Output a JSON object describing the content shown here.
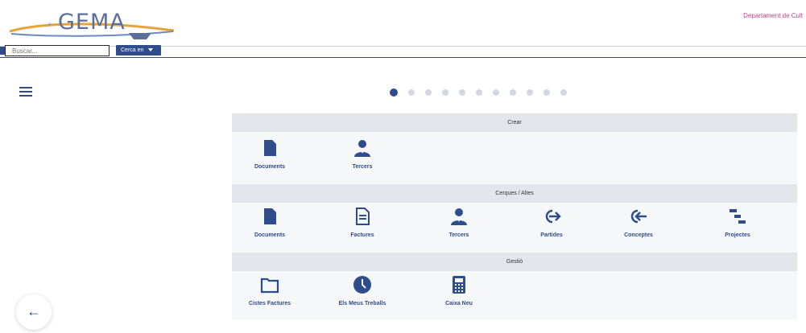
{
  "header": {
    "logo_text": "GEMA",
    "logo_small_text": "e·",
    "department": "Departament de Cult"
  },
  "search": {
    "placeholder": "Buscar...",
    "select_label": "Cerca en"
  },
  "carousel": {
    "total": 11,
    "active": 1
  },
  "sections": [
    {
      "title": "Crear",
      "items": [
        {
          "label": "Documents",
          "icon": "document-icon"
        },
        {
          "label": "Tercers",
          "icon": "user-icon"
        }
      ]
    },
    {
      "title": "Cerques / Altes",
      "items": [
        {
          "label": "Documents",
          "icon": "document-icon"
        },
        {
          "label": "Factures",
          "icon": "invoice-icon"
        },
        {
          "label": "Tercers",
          "icon": "user-icon"
        },
        {
          "label": "Partides",
          "icon": "arrow-right-icon"
        },
        {
          "label": "Conceptes",
          "icon": "arrow-left-icon"
        },
        {
          "label": "Projectes",
          "icon": "tasks-icon"
        }
      ]
    },
    {
      "title": "Gestió",
      "items": [
        {
          "label": "Cistes Factures",
          "icon": "folder-icon"
        },
        {
          "label": "Els Meus Treballs",
          "icon": "clock-icon"
        },
        {
          "label": "Caixa Neu",
          "icon": "calculator-icon"
        }
      ]
    }
  ],
  "colors": {
    "accent": "#2f4d8a",
    "section_bg": "#e2e5ea",
    "panel_bg": "#f6f7f9"
  }
}
